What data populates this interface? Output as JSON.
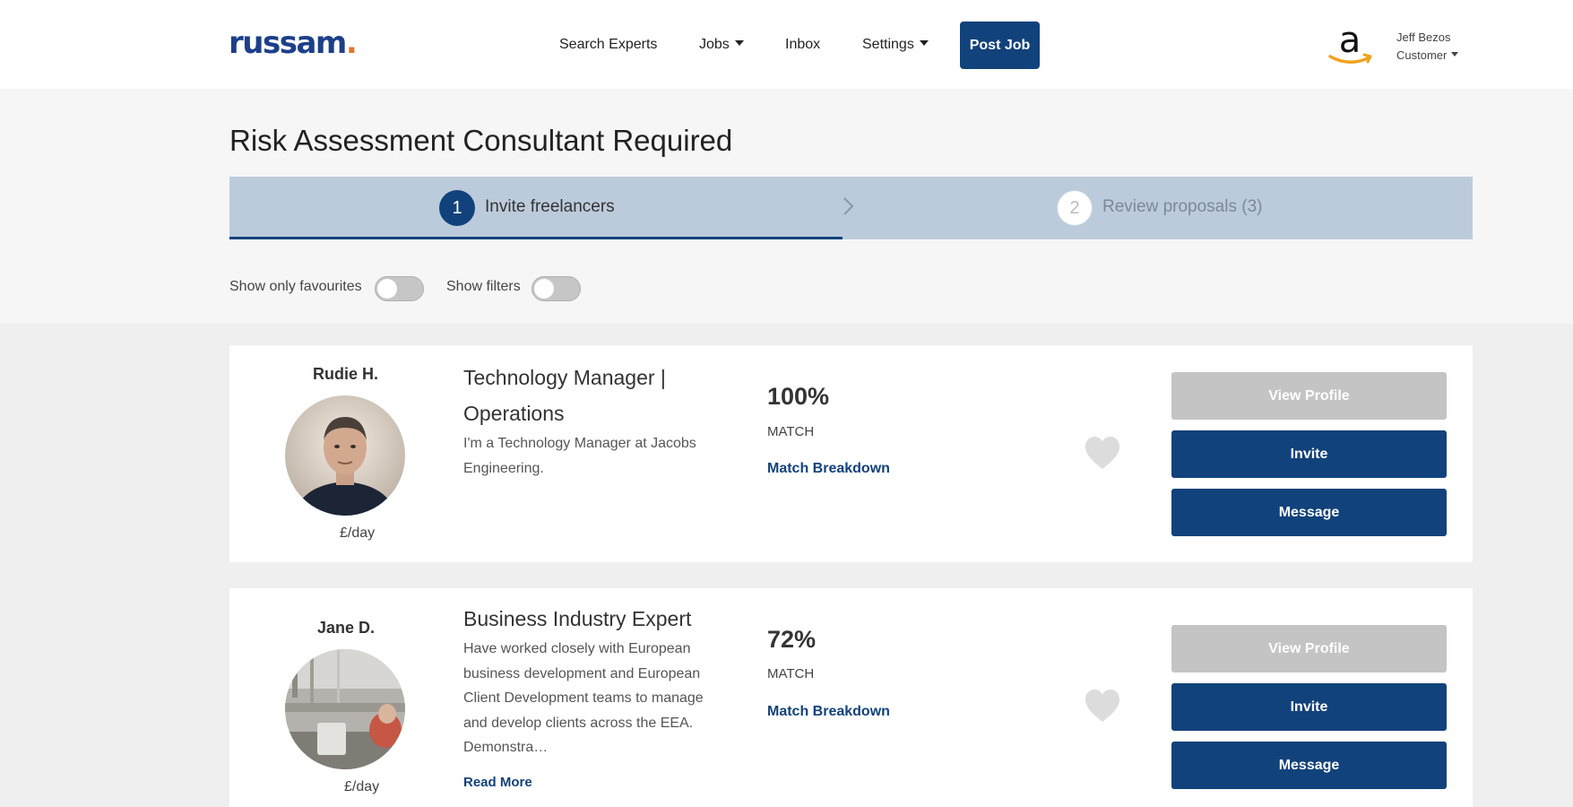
{
  "brand": {
    "logo_text": "russam",
    "logo_dot": "."
  },
  "nav": {
    "search_experts": "Search Experts",
    "jobs": "Jobs",
    "inbox": "Inbox",
    "settings": "Settings",
    "post_job": "Post Job"
  },
  "user": {
    "name": "Jeff Bezos",
    "role": "Customer",
    "company_logo_text": "a"
  },
  "page": {
    "title": "Risk Assessment Consultant Required"
  },
  "steps": [
    {
      "number": "1",
      "label": "Invite freelancers",
      "active": true
    },
    {
      "number": "2",
      "label": "Review proposals (3)",
      "active": false
    }
  ],
  "filters": {
    "favourites_label": "Show only favourites",
    "favourites_on": false,
    "filters_label": "Show filters",
    "filters_on": false
  },
  "freelancers": [
    {
      "name": "Rudie H.",
      "rate": "£/day",
      "title": "Technology Manager | Operations",
      "description": "I'm a Technology Manager at Jacobs Engineering.",
      "match_percent": "100%",
      "match_label": "MATCH",
      "match_link": "Match Breakdown",
      "favourite": false,
      "buttons": {
        "view_profile": "View Profile",
        "invite": "Invite",
        "message": "Message"
      }
    },
    {
      "name": "Jane D.",
      "rate": "£/day",
      "title": "Business Industry Expert",
      "description": "Have worked closely with European business development and European Client Development teams to manage and develop clients across the EEA. Demonstra…",
      "read_more": "Read More",
      "match_percent": "72%",
      "match_label": "MATCH",
      "match_link": "Match Breakdown",
      "favourite": false,
      "buttons": {
        "view_profile": "View Profile",
        "invite": "Invite",
        "message": "Message"
      }
    }
  ],
  "colors": {
    "primary": "#12427b",
    "accent_orange": "#e8742a",
    "stepper_bg": "#bccbdb",
    "disabled_button": "#c4c4c4"
  }
}
